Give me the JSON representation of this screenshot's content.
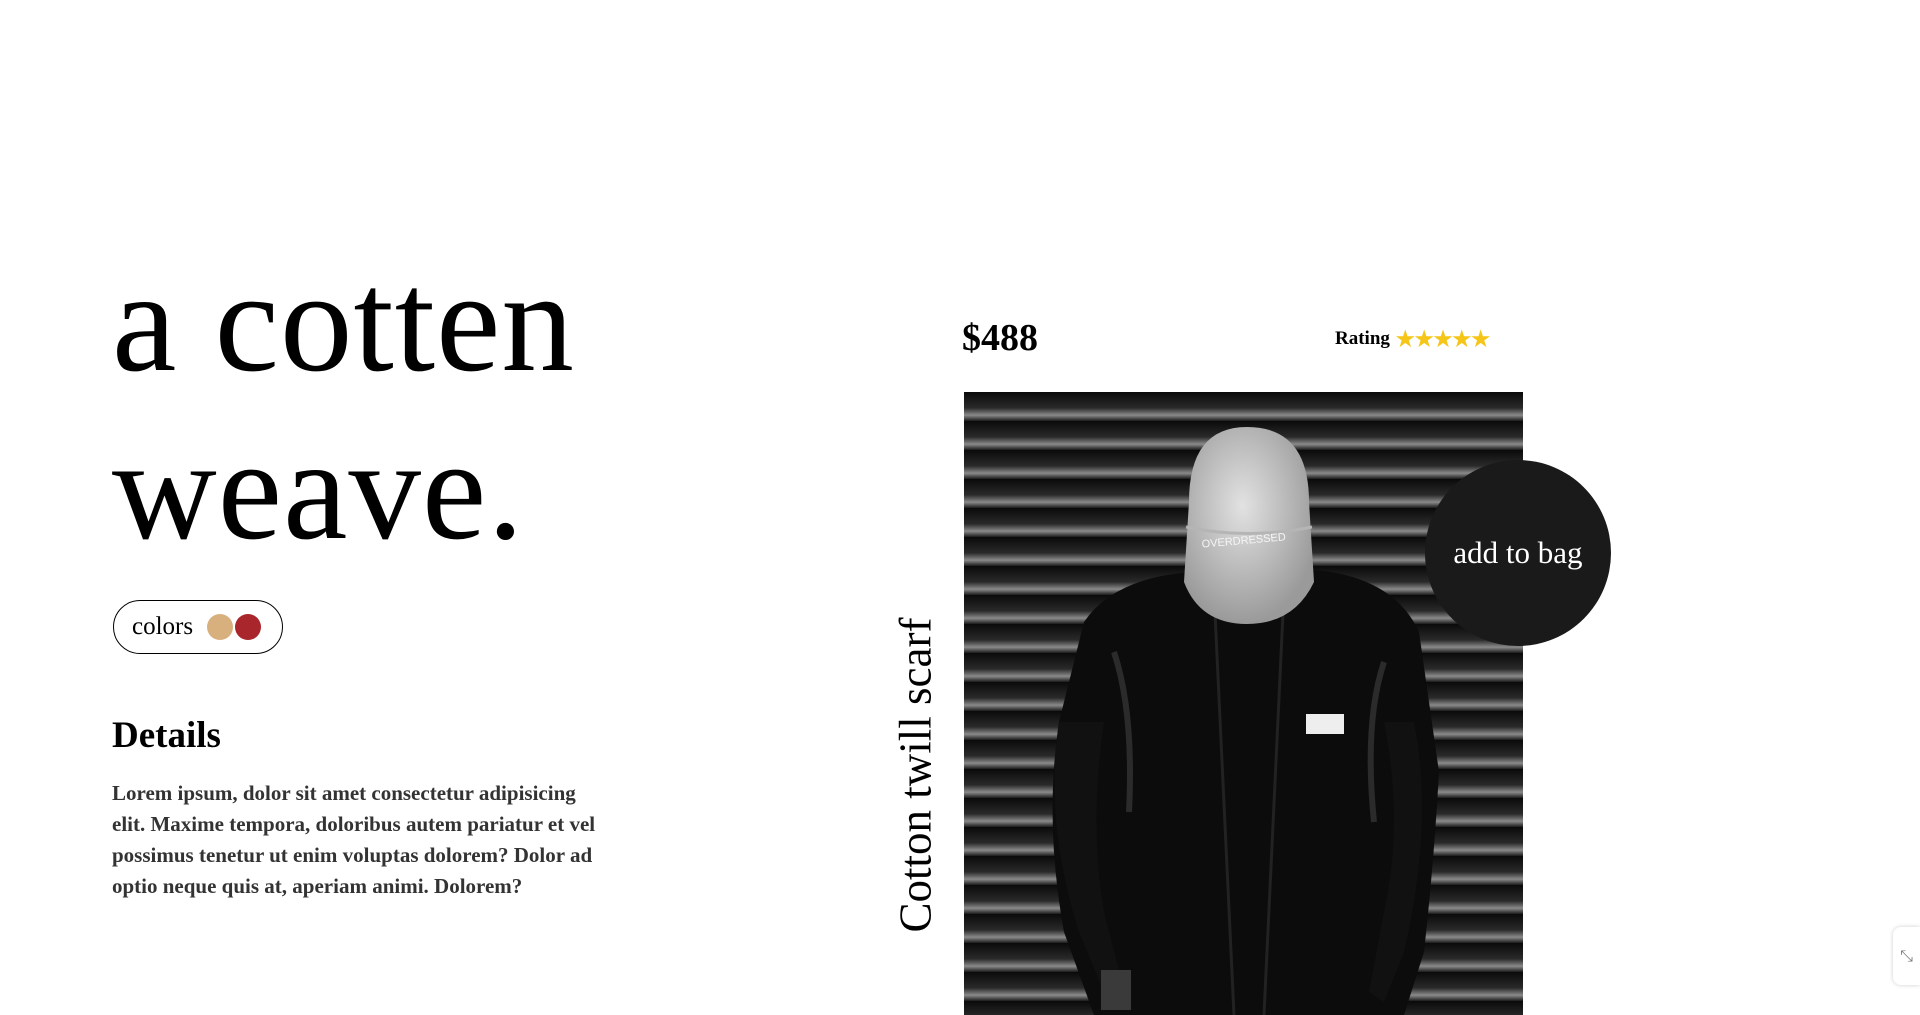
{
  "hero": {
    "line1": "a cotten",
    "line2": "weave."
  },
  "colors": {
    "label": "colors",
    "swatches": [
      "#d8b07e",
      "#a8262c"
    ]
  },
  "details": {
    "title": "Details",
    "body": "Lorem ipsum, dolor sit amet consectetur adipisicing elit. Maxime tempora, doloribus autem pariatur et vel possimus tenetur ut enim voluptas dolorem? Dolor ad optio neque quis at, aperiam animi. Dolorem?"
  },
  "product": {
    "price": "$488",
    "rating_label": "Rating",
    "rating_stars": 5,
    "star_char": "★",
    "name": "Cotton twill scarf",
    "add_to_bag_label": "add to bag",
    "image_alt": "model in black jacket and white cap"
  },
  "side_widget": {
    "icon": "expand-icon",
    "glyph": "⤡"
  }
}
